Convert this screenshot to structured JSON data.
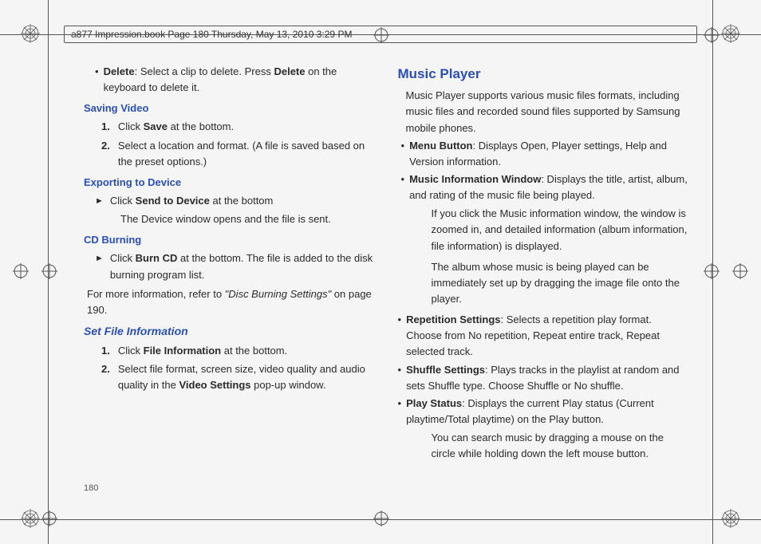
{
  "header": {
    "text": "a877 Impression.book  Page 180  Thursday, May 13, 2010  3:29 PM"
  },
  "pageNumber": "180",
  "left": {
    "deleteRow": {
      "bullet": "•",
      "bold1": "Delete",
      "text1": ": Select a clip to delete. Press ",
      "bold2": "Delete",
      "text2": " on the keyboard to delete it."
    },
    "savingVideoHead": "Saving Video",
    "sv1": {
      "num": "1.",
      "pre": "Click ",
      "bold": "Save",
      "post": " at the bottom."
    },
    "sv2": {
      "num": "2.",
      "text": "Select a location and format. (A file is saved based on the preset options.)"
    },
    "exportingHead": "Exporting to Device",
    "exp": {
      "arrow": "►",
      "pre": "Click ",
      "bold": "Send to Device",
      "post": " at the bottom"
    },
    "expSub": "The Device window opens and the file is sent.",
    "cdHead": "CD Burning",
    "cd": {
      "arrow": "►",
      "pre": "Click ",
      "bold": "Burn CD",
      "post": " at the bottom. The file is added to the disk burning program list."
    },
    "cdPara": {
      "pre": "For more information, refer to ",
      "italic": "\"Disc Burning Settings\" ",
      "post": " on page 190."
    },
    "setFileHead": "Set File Information",
    "sf1": {
      "num": "1.",
      "pre": "Click ",
      "bold": "File Information",
      "post": " at the bottom."
    },
    "sf2": {
      "num": "2.",
      "pre": "Select file format, screen size, video quality and audio quality in the ",
      "bold": "Video Settings",
      "post": " pop-up window."
    }
  },
  "right": {
    "musicPlayerHead": "Music Player",
    "intro": "Music Player supports various music files formats, including music files and recorded sound files supported by Samsung mobile phones.",
    "menuBtn": {
      "bullet": "•",
      "bold": "Menu Button",
      "text": ": Displays Open, Player settings, Help and Version information."
    },
    "miw": {
      "bullet": "•",
      "bold": "Music Information Window",
      "text": ": Displays the title, artist, album, and rating of the music file being played."
    },
    "miwSub1": "If you click the Music information window, the window is zoomed in, and detailed information (album information, file information) is displayed.",
    "miwSub2": "The album whose music is being played can be immediately set up by dragging the image file onto the player.",
    "rep": {
      "bullet": "•",
      "bold": "Repetition Settings",
      "text": ": Selects a repetition play format. Choose from No repetition, Repeat entire track, Repeat selected track."
    },
    "shuf": {
      "bullet": "•",
      "bold": "Shuffle Settings",
      "text": ": Plays tracks in the playlist at random and sets Shuffle type. Choose Shuffle or No shuffle."
    },
    "play": {
      "bullet": "•",
      "bold": "Play Status",
      "text": ": Displays the current Play status (Current playtime/Total playtime) on the Play button."
    },
    "playSub": "You can search music by dragging a mouse on the circle while holding down the left mouse button."
  }
}
